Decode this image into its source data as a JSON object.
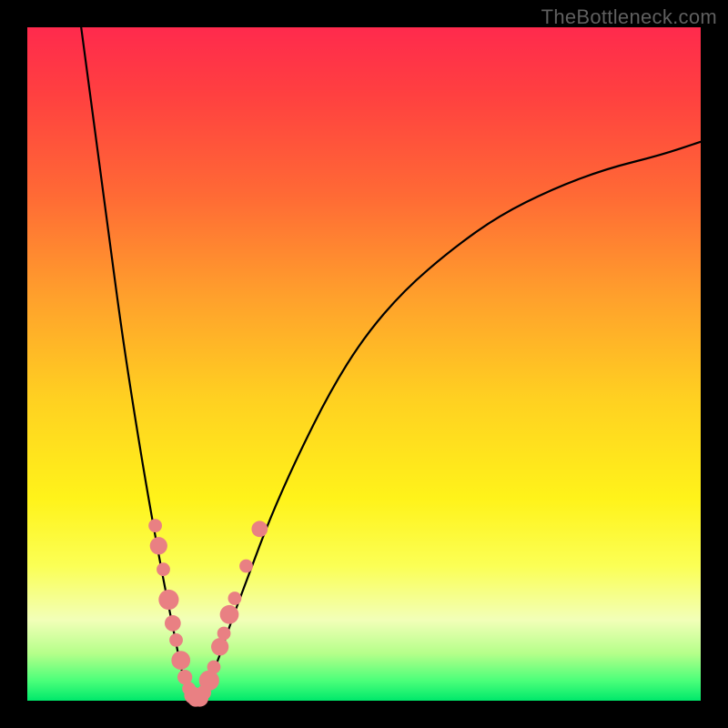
{
  "watermark": "TheBottleneck.com",
  "colors": {
    "background": "#000000",
    "gradient_top": "#ff2a4d",
    "gradient_bottom": "#00e86b",
    "curve_stroke": "#000000",
    "marker_fill": "#e98083",
    "watermark_text": "#5f5f5f"
  },
  "chart_data": {
    "type": "line",
    "title": "",
    "xlabel": "",
    "ylabel": "",
    "xlim": [
      0,
      100
    ],
    "ylim": [
      0,
      100
    ],
    "grid": false,
    "legend": false,
    "series": [
      {
        "name": "bottleneck-curve-left",
        "x": [
          8,
          10,
          12,
          14,
          16,
          18,
          20,
          22,
          23,
          24,
          25
        ],
        "y": [
          100,
          85,
          70,
          55,
          42,
          30,
          19,
          9,
          4,
          1,
          0
        ]
      },
      {
        "name": "bottleneck-curve-right",
        "x": [
          25,
          26,
          28,
          30,
          33,
          36,
          40,
          45,
          50,
          56,
          63,
          70,
          78,
          86,
          94,
          100
        ],
        "y": [
          0,
          1,
          5,
          11,
          19,
          27,
          36,
          46,
          54,
          61,
          67,
          72,
          76,
          79,
          81,
          83
        ]
      }
    ],
    "markers": [
      {
        "x": 19.0,
        "y": 26.0,
        "r": 1.0
      },
      {
        "x": 19.5,
        "y": 23.0,
        "r": 1.3
      },
      {
        "x": 20.2,
        "y": 19.5,
        "r": 1.0
      },
      {
        "x": 21.0,
        "y": 15.0,
        "r": 1.5
      },
      {
        "x": 21.6,
        "y": 11.5,
        "r": 1.2
      },
      {
        "x": 22.1,
        "y": 9.0,
        "r": 1.0
      },
      {
        "x": 22.8,
        "y": 6.0,
        "r": 1.4
      },
      {
        "x": 23.4,
        "y": 3.5,
        "r": 1.1
      },
      {
        "x": 24.0,
        "y": 1.8,
        "r": 1.0
      },
      {
        "x": 24.6,
        "y": 0.8,
        "r": 1.3
      },
      {
        "x": 25.0,
        "y": 0.3,
        "r": 1.2
      },
      {
        "x": 25.6,
        "y": 0.4,
        "r": 1.3
      },
      {
        "x": 26.2,
        "y": 1.2,
        "r": 1.1
      },
      {
        "x": 27.0,
        "y": 3.0,
        "r": 1.5
      },
      {
        "x": 27.7,
        "y": 5.0,
        "r": 1.0
      },
      {
        "x": 28.6,
        "y": 8.0,
        "r": 1.3
      },
      {
        "x": 29.2,
        "y": 10.0,
        "r": 1.0
      },
      {
        "x": 30.0,
        "y": 12.8,
        "r": 1.4
      },
      {
        "x": 30.8,
        "y": 15.2,
        "r": 1.0
      },
      {
        "x": 32.5,
        "y": 20.0,
        "r": 1.0
      },
      {
        "x": 34.5,
        "y": 25.5,
        "r": 1.2
      }
    ],
    "annotations": []
  }
}
